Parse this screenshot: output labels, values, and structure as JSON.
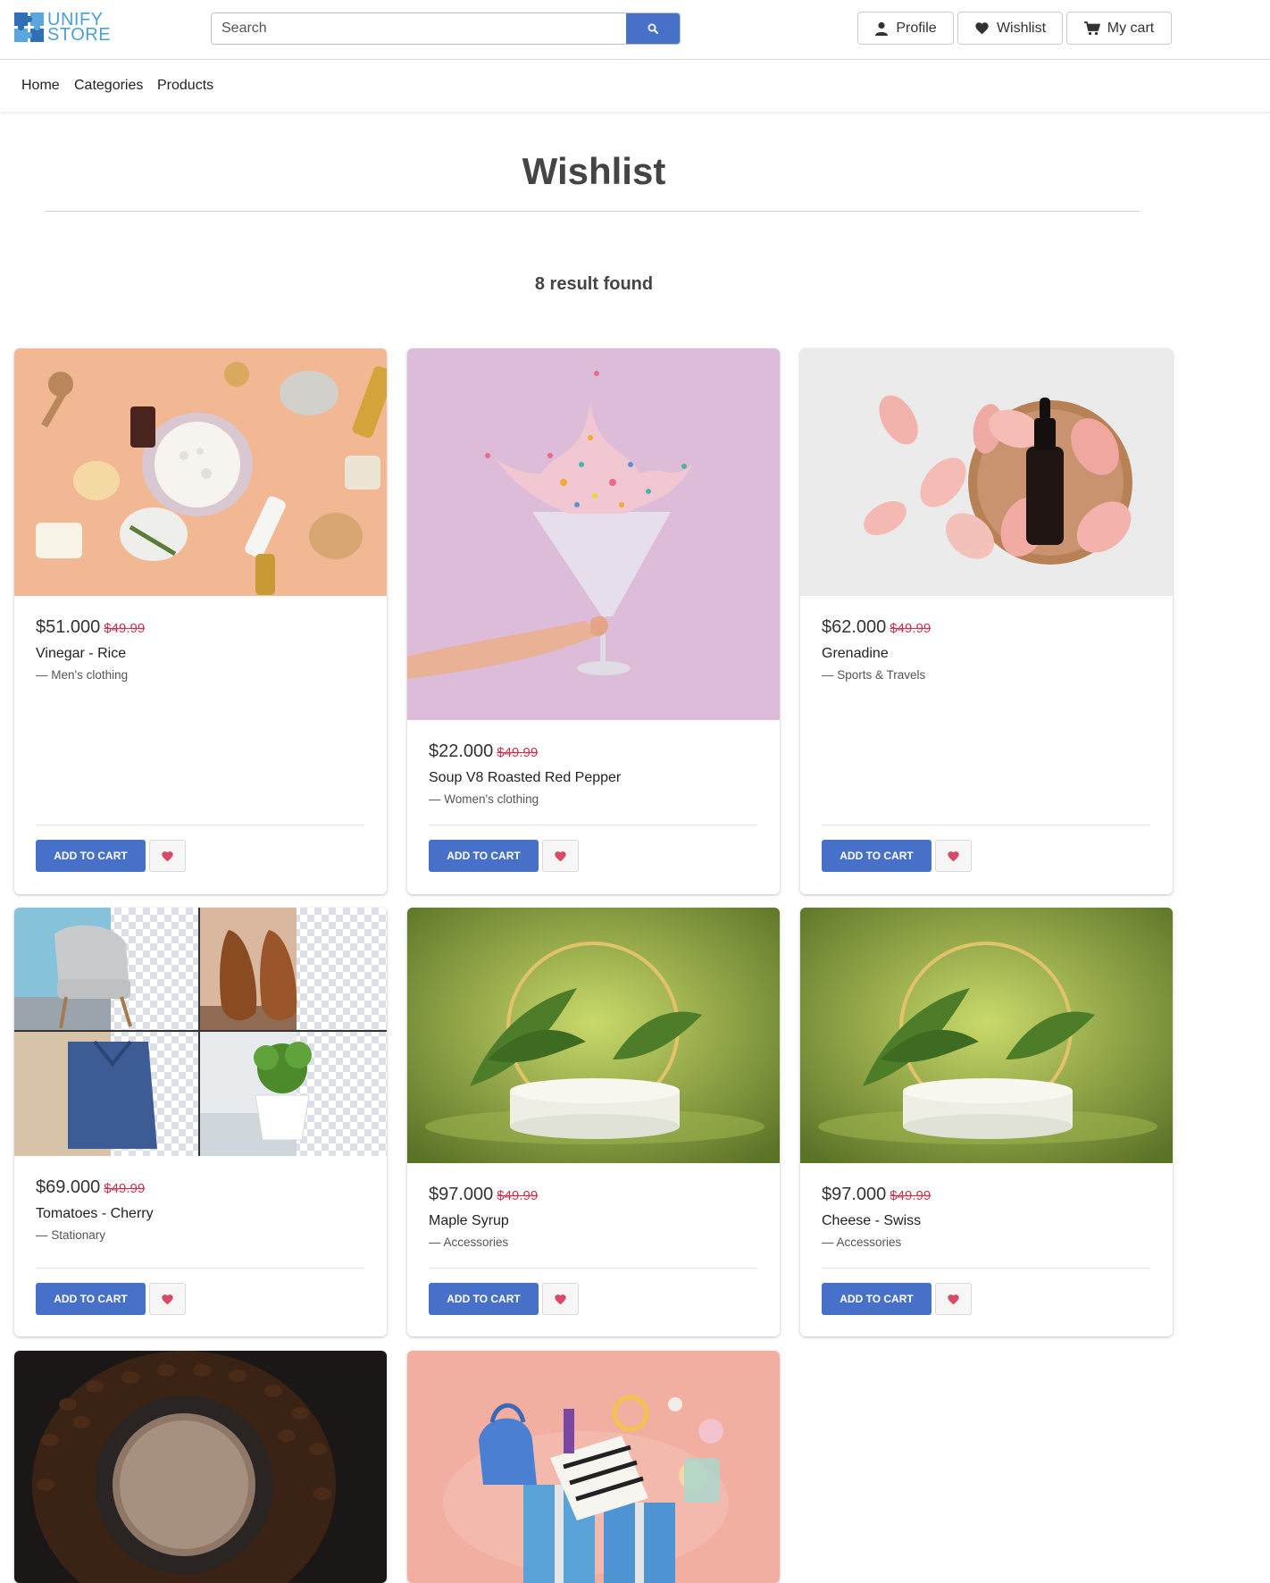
{
  "brand": {
    "line1": "UNIFY",
    "line2": "STORE"
  },
  "search": {
    "placeholder": "Search"
  },
  "header_buttons": {
    "profile": "Profile",
    "wishlist": "Wishlist",
    "cart": "My cart"
  },
  "nav": {
    "home": "Home",
    "categories": "Categories",
    "products": "Products"
  },
  "page": {
    "title": "Wishlist",
    "result_count": "8 result found"
  },
  "colors": {
    "primary": "#4770c9",
    "strike_price": "#c9354e",
    "heart": "#d94a64",
    "logo": "#4a9fd8"
  },
  "products": [
    {
      "price": "$51.000",
      "old_price": "$49.99",
      "name": "Vinegar - Rice",
      "category": "— Men's clothing",
      "add_label": "ADD TO CART",
      "image": "cosmetics flat lay on peach background"
    },
    {
      "price": "$22.000",
      "old_price": "$49.99",
      "name": "Soup V8 Roasted Red Pepper",
      "category": "— Women's clothing",
      "add_label": "ADD TO CART",
      "image": "hand holding glass with sprinkles on purple"
    },
    {
      "price": "$62.000",
      "old_price": "$49.99",
      "name": "Grenadine",
      "category": "— Sports & Travels",
      "add_label": "ADD TO CART",
      "image": "serum bottle with rose petals"
    },
    {
      "price": "$69.000",
      "old_price": "$49.99",
      "name": "Tomatoes - Cherry",
      "category": "— Stationary",
      "add_label": "ADD TO CART",
      "image": "chair, shoes, shirt and plant collage"
    },
    {
      "price": "$97.000",
      "old_price": "$49.99",
      "name": "Maple Syrup",
      "category": "— Accessories",
      "add_label": "ADD TO CART",
      "image": "podium with palm leaves on green"
    },
    {
      "price": "$97.000",
      "old_price": "$49.99",
      "name": "Cheese - Swiss",
      "category": "— Accessories",
      "add_label": "ADD TO CART",
      "image": "podium with palm leaves on green"
    },
    {
      "image": "coffee cup with coffee beans"
    },
    {
      "image": "gift boxes and accessories on pink"
    }
  ]
}
